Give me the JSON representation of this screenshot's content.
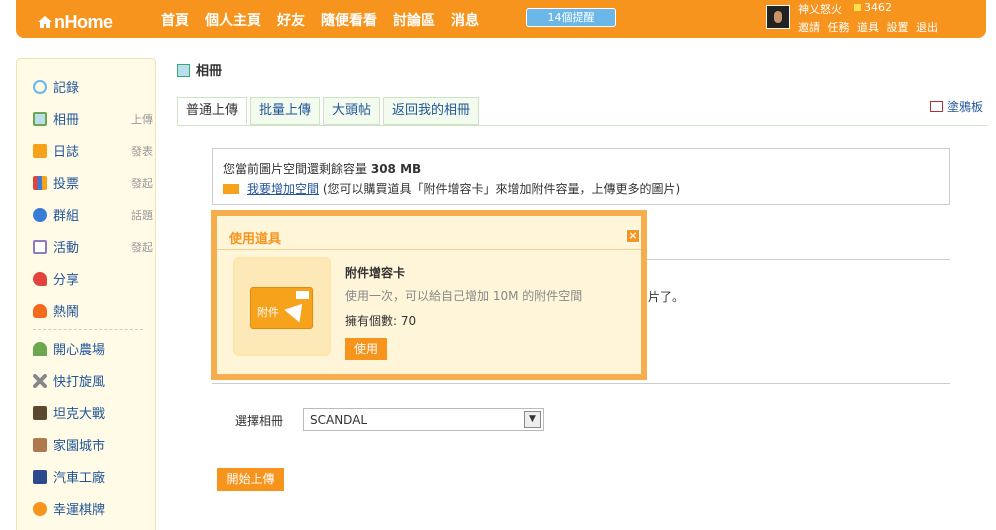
{
  "topbar": {
    "logo": "nHome",
    "nav": [
      "首頁",
      "個人主頁",
      "好友",
      "隨便看看",
      "討論區",
      "消息"
    ],
    "reminders": "14個提醒",
    "user": {
      "name": "神乂怒火",
      "coins": "3462",
      "links": [
        "邀請",
        "任務",
        "道具",
        "設置",
        "退出"
      ]
    }
  },
  "sidebar": {
    "items": [
      {
        "label": "記錄",
        "action": "",
        "icon": "speech-bubble-icon",
        "color": "#6ab7e8"
      },
      {
        "label": "相冊",
        "action": "上傳",
        "icon": "photo-icon",
        "color": "#6aa84f"
      },
      {
        "label": "日誌",
        "action": "發表",
        "icon": "notebook-icon",
        "color": "#f7a21b"
      },
      {
        "label": "投票",
        "action": "發起",
        "icon": "bar-chart-icon",
        "color": "#e0443a"
      },
      {
        "label": "群組",
        "action": "話題",
        "icon": "people-icon",
        "color": "#3a7bd5"
      },
      {
        "label": "活動",
        "action": "發起",
        "icon": "calendar-icon",
        "color": "#8e7cc3"
      },
      {
        "label": "分享",
        "action": "",
        "icon": "heart-icon",
        "color": "#e0443a"
      },
      {
        "label": "熱鬧",
        "action": "",
        "icon": "fire-icon",
        "color": "#f26a1b"
      },
      {
        "label": "開心農場",
        "action": "",
        "icon": "sprout-icon",
        "color": "#6aa84f"
      },
      {
        "label": "快打旋風",
        "action": "",
        "icon": "swords-icon",
        "color": "#888888"
      },
      {
        "label": "坦克大戰",
        "action": "",
        "icon": "tank-icon",
        "color": "#5b4a2e"
      },
      {
        "label": "家園城市",
        "action": "",
        "icon": "house-icon",
        "color": "#b07a4f"
      },
      {
        "label": "汽車工廠",
        "action": "",
        "icon": "factory-icon",
        "color": "#2b4a8e"
      },
      {
        "label": "幸運棋牌",
        "action": "",
        "icon": "card-game-icon",
        "color": "#f7941d"
      }
    ]
  },
  "page": {
    "title": "相冊",
    "tabs": [
      "普通上傳",
      "批量上傳",
      "大頭帖",
      "返回我的相冊"
    ],
    "graffiti": "塗鴉板",
    "info": {
      "line1_prefix": "您當前圖片空間還剩餘容量",
      "line1_value": "308 MB",
      "link": "我要增加空間",
      "line2_suffix": "(您可以購買道具「附件增容卡」來增加附件容量，上傳更多的圖片)"
    },
    "hidden_text_tail": "片了。",
    "album_label": "選擇相冊",
    "album_value": "SCANDAL",
    "start_button": "開始上傳"
  },
  "dialog": {
    "title": "使用道具",
    "close": "×",
    "item_name": "附件增容卡",
    "item_desc": "使用一次，可以給自己增加 10M 的附件空間",
    "owned": "擁有個數: 70",
    "card_label": "附件",
    "use_button": "使用"
  }
}
